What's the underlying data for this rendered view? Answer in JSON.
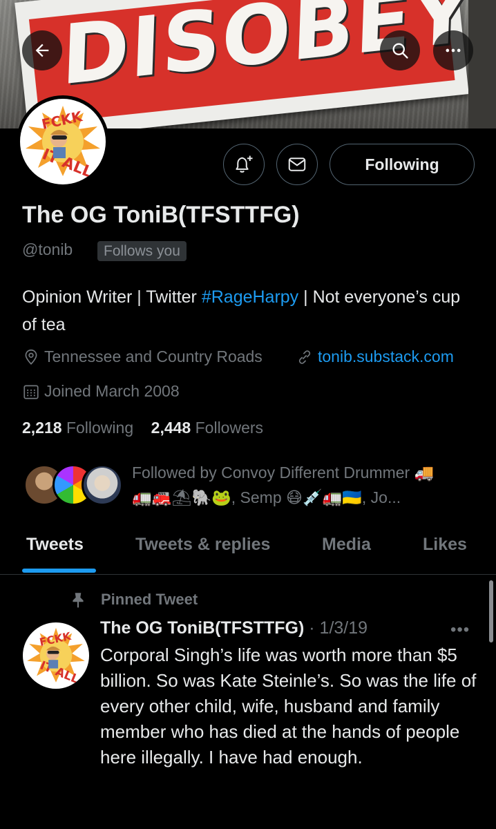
{
  "banner": {
    "sign_text": "DISOBEY"
  },
  "profile": {
    "display_name": "The OG ToniB(TFSTTFG)",
    "handle": "@tonib",
    "follows_you": "Follows you",
    "follow_button": "Following",
    "bio_prefix": "Opinion Writer | Twitter ",
    "bio_hashtag": "#RageHarpy",
    "bio_suffix": " | Not everyone’s cup of tea",
    "location": "Tennessee and Country Roads",
    "website": "tonib.substack.com",
    "joined": "Joined March 2008",
    "following_count": "2,218",
    "following_label": "Following",
    "followers_count": "2,448",
    "followers_label": "Followers",
    "followed_by_line1": "Followed by Convoy Different Drummer 🚚",
    "followed_by_line2": "🚛🚒⛱🐘🐸, Semp 😷💉🚛🇺🇦, Jo..."
  },
  "tabs": [
    {
      "label": "Tweets",
      "active": true
    },
    {
      "label": "Tweets & replies",
      "active": false
    },
    {
      "label": "Media",
      "active": false
    },
    {
      "label": "Likes",
      "active": false
    }
  ],
  "pinned_label": "Pinned Tweet",
  "tweet": {
    "author": "The OG ToniB(TFSTTFG)",
    "date": "· 1/3/19",
    "more": "•••",
    "text": "Corporal Singh’s life was worth more than $5 billion. So was Kate Steinle’s. So was the life of every other child, wife, husband and family member who has died at the hands of people here illegally. I have had enough."
  },
  "avatar_text": "FCKK IT ALL",
  "colors": {
    "accent": "#1d9bf0",
    "background": "#000000",
    "muted": "#71767b",
    "banner_red": "#d7312a"
  },
  "icons": [
    "back-arrow-icon",
    "search-icon",
    "more-icon",
    "notification-bell-icon",
    "message-envelope-icon",
    "location-pin-icon",
    "link-icon",
    "calendar-icon",
    "pin-icon"
  ]
}
